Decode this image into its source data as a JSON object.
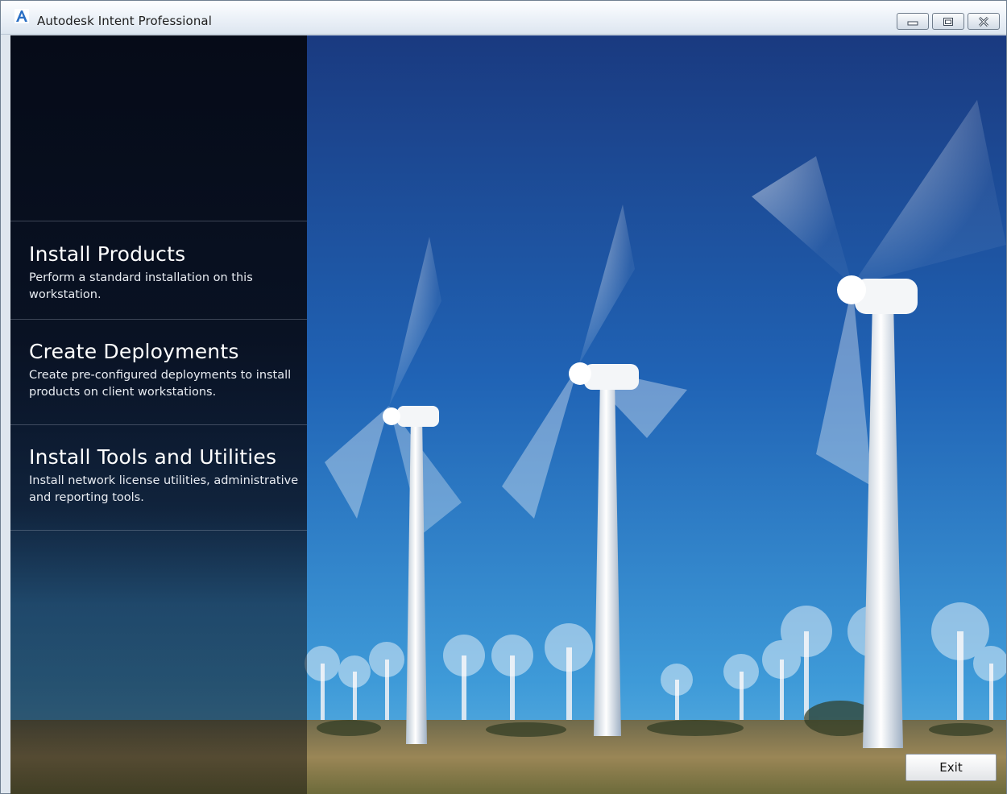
{
  "window": {
    "title": "Autodesk Intent Professional",
    "icon": "autodesk-a-icon",
    "controls": [
      "minimize-icon",
      "maximize-icon",
      "close-icon"
    ]
  },
  "menu": {
    "items": [
      {
        "title": "Install Products",
        "description": "Perform a standard installation on this workstation."
      },
      {
        "title": "Create Deployments",
        "description": "Create pre-configured deployments to install products on client workstations."
      },
      {
        "title": "Install Tools and Utilities",
        "description": "Install network license utilities, administrative and reporting tools."
      }
    ]
  },
  "footer": {
    "exit_label": "Exit"
  },
  "colors": {
    "sky_top": "#1d3f86",
    "sky_bottom": "#2f8fd0",
    "panel": "#070d1a",
    "ground": "#8a7a55"
  }
}
